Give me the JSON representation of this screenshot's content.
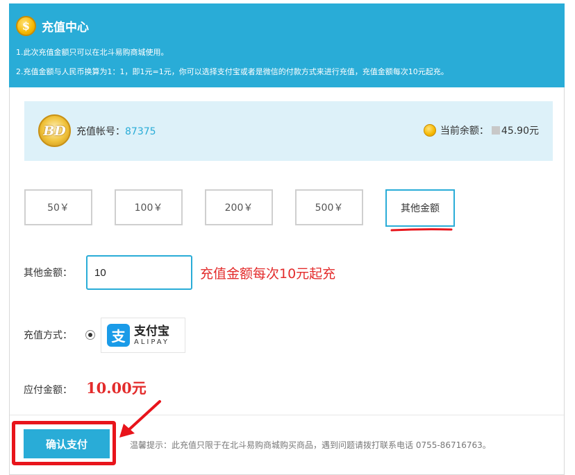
{
  "header": {
    "icon": "dollar-coin-icon",
    "icon_glyph": "$",
    "title": "充值中心",
    "note1": "1.此次充值金额只可以在北斗易购商城使用。",
    "note2": "2.充值金额与人民币换算为1：1，即1元=1元，你可以选择支付宝或者是微信的付款方式来进行充值，充值金额每次10元起充。"
  },
  "account": {
    "logo_text": "BD",
    "label": "充值帐号：",
    "number": "87375",
    "balance_label": "当前余额：",
    "balance_value": "45.90元"
  },
  "amounts": [
    {
      "label": "50￥"
    },
    {
      "label": "100￥"
    },
    {
      "label": "200￥"
    },
    {
      "label": "500￥"
    },
    {
      "label": "其他金额",
      "selected": true
    }
  ],
  "other_amount": {
    "label": "其他金额：",
    "value": "10",
    "hint": "充值金额每次10元起充"
  },
  "payment": {
    "label": "充值方式：",
    "method_cn": "支付宝",
    "method_en": "ALIPAY",
    "icon": "alipay-icon",
    "icon_glyph": "支"
  },
  "payable": {
    "label": "应付金额：",
    "value": "10.00元"
  },
  "footer": {
    "confirm_label": "确认支付",
    "tip": "温馨提示：此充值只限于在北斗易购商城购买商品，遇到问题请拨打联系电话 0755-86716763。"
  },
  "colors": {
    "accent": "#29acd7",
    "annotation_red": "#e8141b",
    "hint_red": "#e32b2b"
  }
}
